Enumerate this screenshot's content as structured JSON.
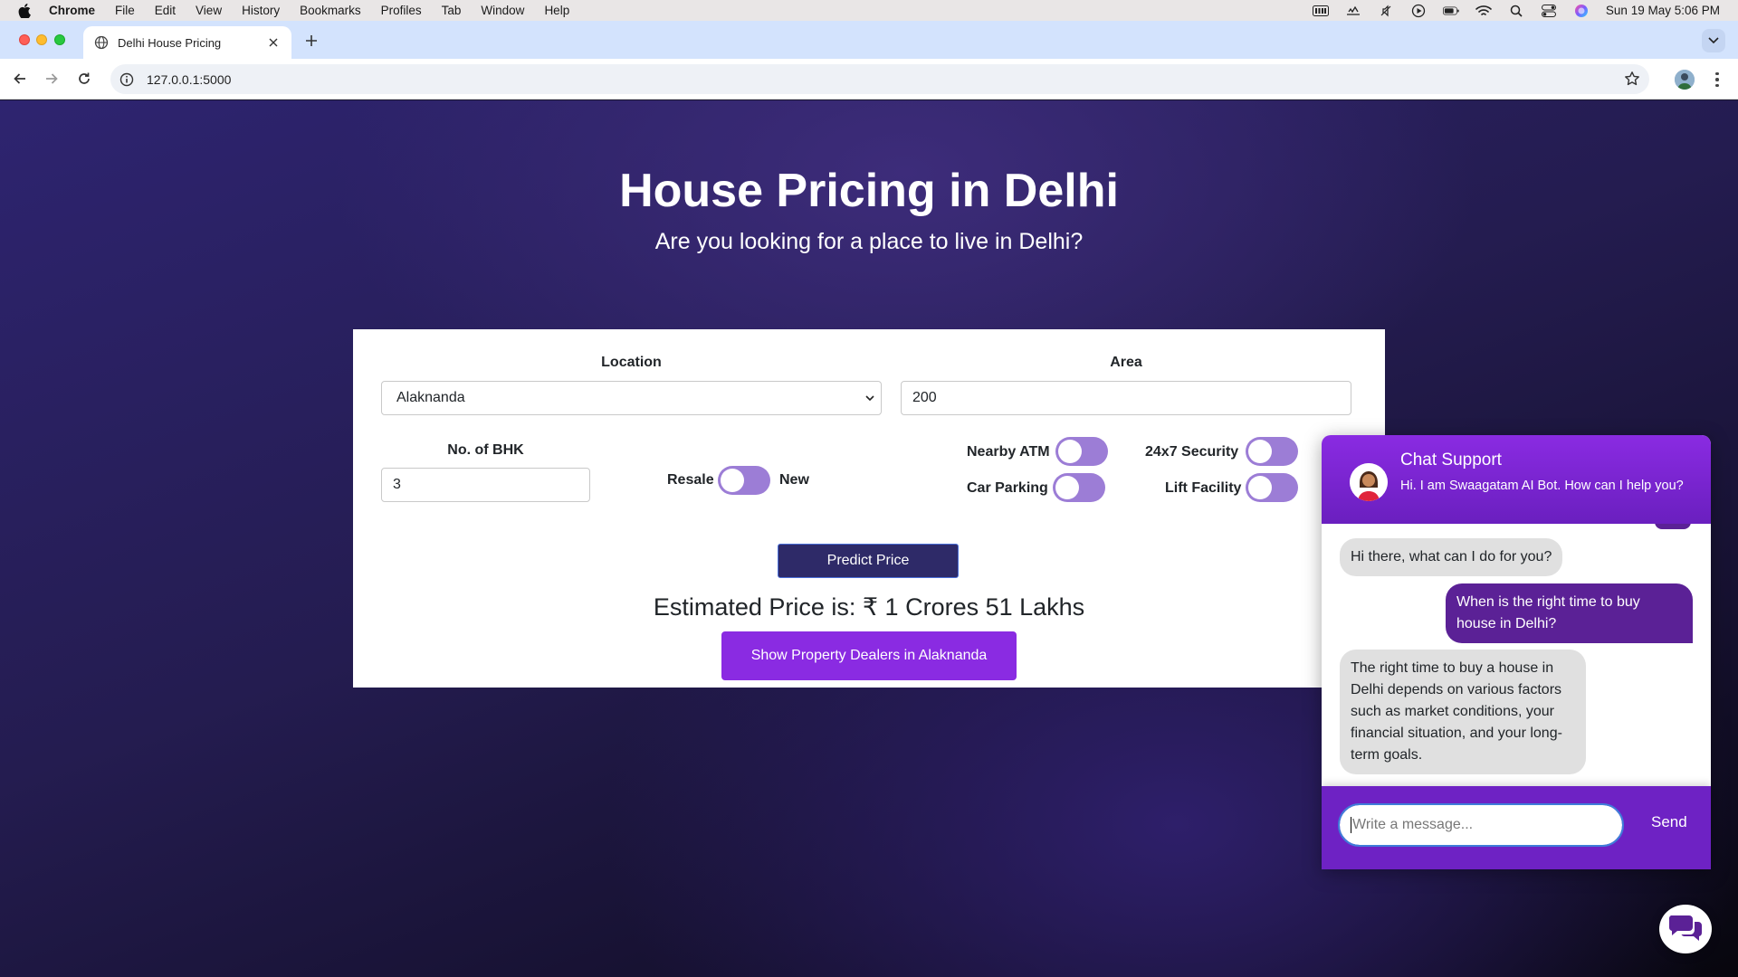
{
  "menubar": {
    "app": "Chrome",
    "items": [
      "File",
      "Edit",
      "View",
      "History",
      "Bookmarks",
      "Profiles",
      "Tab",
      "Window",
      "Help"
    ],
    "clock": "Sun 19 May  5:06 PM"
  },
  "browser": {
    "tab_title": "Delhi House Pricing",
    "url": "127.0.0.1:5000"
  },
  "hero": {
    "title": "House Pricing in Delhi",
    "subtitle": "Are you looking for a place to live in Delhi?"
  },
  "form": {
    "location_label": "Location",
    "location_value": "Alaknanda",
    "area_label": "Area",
    "area_value": "200",
    "bhk_label": "No. of BHK",
    "bhk_value": "3",
    "resale_label": "Resale",
    "new_label": "New",
    "resale_new_is_new": false,
    "nearby_atm_label": "Nearby ATM",
    "nearby_atm_on": false,
    "car_parking_label": "Car Parking",
    "car_parking_on": false,
    "security_label": "24x7 Security",
    "security_on": false,
    "lift_label": "Lift Facility",
    "lift_on": false,
    "predict_button": "Predict Price",
    "estimate_text": "Estimated Price is: ₹ 1 Crores 51 Lakhs",
    "dealers_button": "Show Property Dealers in Alaknanda"
  },
  "chat": {
    "title": "Chat Support",
    "greeting": "Hi. I am Swaagatam AI Bot. How can I help you?",
    "messages": [
      {
        "from": "bot",
        "text": "Hi there, what can I do for you?"
      },
      {
        "from": "user",
        "text": "When is the right time to buy house in Delhi?"
      },
      {
        "from": "bot",
        "text": "The right time to buy a house in Delhi depends on various factors such as market conditions, your financial situation, and your long-term goals."
      }
    ],
    "input_placeholder": "Write a message...",
    "send_label": "Send"
  },
  "colors": {
    "accent_purple": "#8a2be2",
    "predict_button": "#2e2a68",
    "toggle_off": "#9c7dd6",
    "user_bubble": "#5b2196"
  }
}
